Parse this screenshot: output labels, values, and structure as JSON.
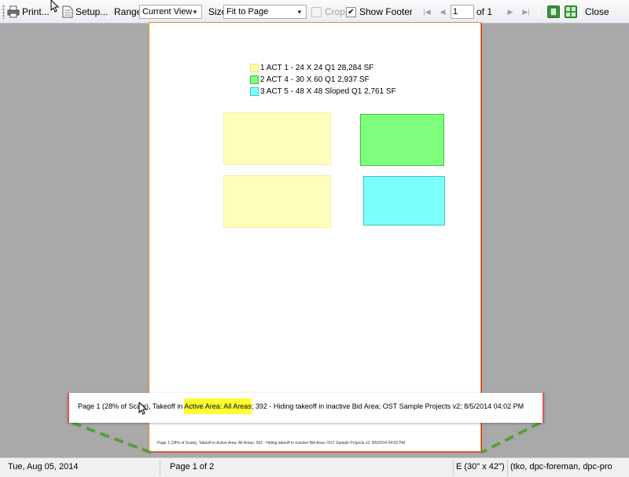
{
  "toolbar": {
    "print_label": "Print...",
    "setup_label": "Setup...",
    "range_label": "Range",
    "range_value": "Current View",
    "size_label": "Size",
    "size_value": "Fit to Page",
    "crop_label": "Crop",
    "crop_checked": false,
    "show_footer_label": "Show Footer",
    "show_footer_checked": true,
    "page_input": "1",
    "page_of": "of 1",
    "close_label": "Close"
  },
  "legend": [
    {
      "label": "1 ACT 1 - 24 X 24 Q1 28,284 SF",
      "color": "#ffffaa"
    },
    {
      "label": "2 ACT 4 - 30 X 60 Q1 2,937 SF",
      "color": "#7dff7d"
    },
    {
      "label": "3 ACT 5 - 48 X 48 Sloped Q1 2,761 SF",
      "color": "#7dffff"
    }
  ],
  "colors": {
    "act1_fill": "#ffffbb",
    "act1_stroke": "#f3f39a",
    "act4_fill": "#7dff7d",
    "act4_stroke": "#3cc43c",
    "act5_fill": "#7dffff",
    "act5_stroke": "#3cc4c4",
    "highlight": "#ffff33",
    "zoom_dash": "#5a9e3a"
  },
  "footer": {
    "zoom_pre": "Page 1 (28% of Scale), Takeoff in ",
    "zoom_highlight": "Active Area: All Areas",
    "zoom_post": "; 392 - Hiding takeoff in inactive Bid Area; OST Sample Projects v2; 8/5/2014 04:02 PM",
    "mini": "Page 1 (28% of Scale), Takeoff in Active Area: All Areas; 392 - Hiding takeoff in inactive Bid Area; OST Sample Projects v2; 8/5/2014 04:02 PM"
  },
  "status": {
    "date": "Tue, Aug 05, 2014",
    "page": "Page 1 of 2",
    "paper": "E (30\" x 42\")",
    "users": "(tko, dpc-foreman, dpc-pro"
  }
}
